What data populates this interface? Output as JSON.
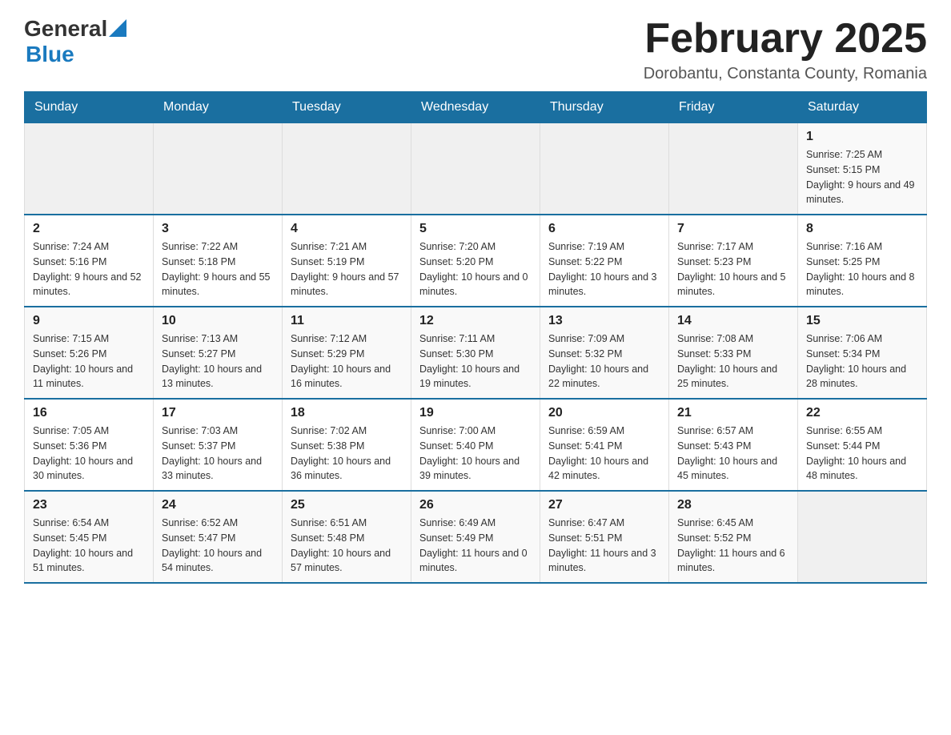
{
  "header": {
    "logo": {
      "general": "General",
      "blue": "Blue",
      "triangle_color": "#1a7abf"
    },
    "title": "February 2025",
    "location": "Dorobantu, Constanta County, Romania"
  },
  "calendar": {
    "days_of_week": [
      "Sunday",
      "Monday",
      "Tuesday",
      "Wednesday",
      "Thursday",
      "Friday",
      "Saturday"
    ],
    "weeks": [
      {
        "days": [
          {
            "date": "",
            "info": ""
          },
          {
            "date": "",
            "info": ""
          },
          {
            "date": "",
            "info": ""
          },
          {
            "date": "",
            "info": ""
          },
          {
            "date": "",
            "info": ""
          },
          {
            "date": "",
            "info": ""
          },
          {
            "date": "1",
            "info": "Sunrise: 7:25 AM\nSunset: 5:15 PM\nDaylight: 9 hours and 49 minutes."
          }
        ]
      },
      {
        "days": [
          {
            "date": "2",
            "info": "Sunrise: 7:24 AM\nSunset: 5:16 PM\nDaylight: 9 hours and 52 minutes."
          },
          {
            "date": "3",
            "info": "Sunrise: 7:22 AM\nSunset: 5:18 PM\nDaylight: 9 hours and 55 minutes."
          },
          {
            "date": "4",
            "info": "Sunrise: 7:21 AM\nSunset: 5:19 PM\nDaylight: 9 hours and 57 minutes."
          },
          {
            "date": "5",
            "info": "Sunrise: 7:20 AM\nSunset: 5:20 PM\nDaylight: 10 hours and 0 minutes."
          },
          {
            "date": "6",
            "info": "Sunrise: 7:19 AM\nSunset: 5:22 PM\nDaylight: 10 hours and 3 minutes."
          },
          {
            "date": "7",
            "info": "Sunrise: 7:17 AM\nSunset: 5:23 PM\nDaylight: 10 hours and 5 minutes."
          },
          {
            "date": "8",
            "info": "Sunrise: 7:16 AM\nSunset: 5:25 PM\nDaylight: 10 hours and 8 minutes."
          }
        ]
      },
      {
        "days": [
          {
            "date": "9",
            "info": "Sunrise: 7:15 AM\nSunset: 5:26 PM\nDaylight: 10 hours and 11 minutes."
          },
          {
            "date": "10",
            "info": "Sunrise: 7:13 AM\nSunset: 5:27 PM\nDaylight: 10 hours and 13 minutes."
          },
          {
            "date": "11",
            "info": "Sunrise: 7:12 AM\nSunset: 5:29 PM\nDaylight: 10 hours and 16 minutes."
          },
          {
            "date": "12",
            "info": "Sunrise: 7:11 AM\nSunset: 5:30 PM\nDaylight: 10 hours and 19 minutes."
          },
          {
            "date": "13",
            "info": "Sunrise: 7:09 AM\nSunset: 5:32 PM\nDaylight: 10 hours and 22 minutes."
          },
          {
            "date": "14",
            "info": "Sunrise: 7:08 AM\nSunset: 5:33 PM\nDaylight: 10 hours and 25 minutes."
          },
          {
            "date": "15",
            "info": "Sunrise: 7:06 AM\nSunset: 5:34 PM\nDaylight: 10 hours and 28 minutes."
          }
        ]
      },
      {
        "days": [
          {
            "date": "16",
            "info": "Sunrise: 7:05 AM\nSunset: 5:36 PM\nDaylight: 10 hours and 30 minutes."
          },
          {
            "date": "17",
            "info": "Sunrise: 7:03 AM\nSunset: 5:37 PM\nDaylight: 10 hours and 33 minutes."
          },
          {
            "date": "18",
            "info": "Sunrise: 7:02 AM\nSunset: 5:38 PM\nDaylight: 10 hours and 36 minutes."
          },
          {
            "date": "19",
            "info": "Sunrise: 7:00 AM\nSunset: 5:40 PM\nDaylight: 10 hours and 39 minutes."
          },
          {
            "date": "20",
            "info": "Sunrise: 6:59 AM\nSunset: 5:41 PM\nDaylight: 10 hours and 42 minutes."
          },
          {
            "date": "21",
            "info": "Sunrise: 6:57 AM\nSunset: 5:43 PM\nDaylight: 10 hours and 45 minutes."
          },
          {
            "date": "22",
            "info": "Sunrise: 6:55 AM\nSunset: 5:44 PM\nDaylight: 10 hours and 48 minutes."
          }
        ]
      },
      {
        "days": [
          {
            "date": "23",
            "info": "Sunrise: 6:54 AM\nSunset: 5:45 PM\nDaylight: 10 hours and 51 minutes."
          },
          {
            "date": "24",
            "info": "Sunrise: 6:52 AM\nSunset: 5:47 PM\nDaylight: 10 hours and 54 minutes."
          },
          {
            "date": "25",
            "info": "Sunrise: 6:51 AM\nSunset: 5:48 PM\nDaylight: 10 hours and 57 minutes."
          },
          {
            "date": "26",
            "info": "Sunrise: 6:49 AM\nSunset: 5:49 PM\nDaylight: 11 hours and 0 minutes."
          },
          {
            "date": "27",
            "info": "Sunrise: 6:47 AM\nSunset: 5:51 PM\nDaylight: 11 hours and 3 minutes."
          },
          {
            "date": "28",
            "info": "Sunrise: 6:45 AM\nSunset: 5:52 PM\nDaylight: 11 hours and 6 minutes."
          },
          {
            "date": "",
            "info": ""
          }
        ]
      }
    ]
  }
}
